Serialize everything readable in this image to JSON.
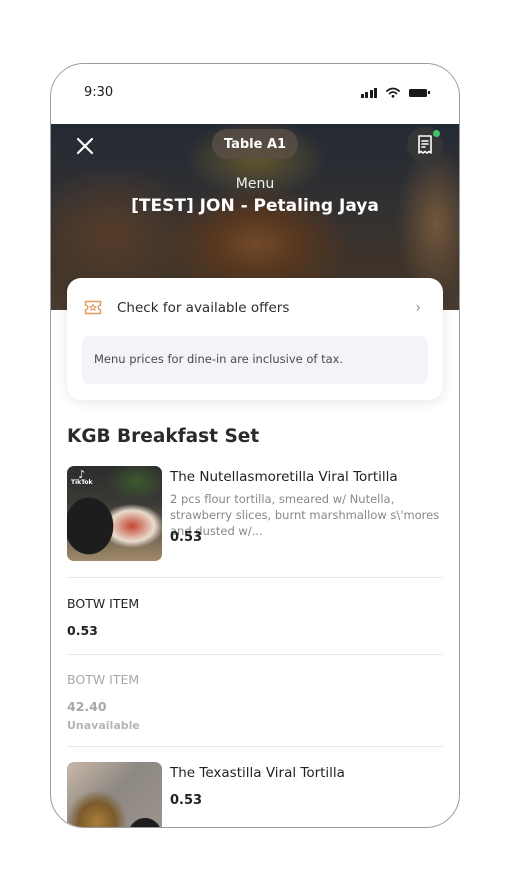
{
  "status_bar": {
    "time": "9:30",
    "icons": [
      "signal-icon",
      "wifi-icon",
      "battery-icon"
    ]
  },
  "header": {
    "close_icon": "close-icon",
    "table_label": "Table A1",
    "receipt_icon": "receipt-icon",
    "receipt_badge_color": "#3fc66b",
    "subtitle": "Menu",
    "title": "[TEST] JON - Petaling Jaya"
  },
  "offers": {
    "icon": "ticket-icon",
    "label": "Check for available offers",
    "chevron": "›",
    "accent_color": "#e39a5a",
    "tax_note": "Menu prices for dine-in are inclusive of tax."
  },
  "menu": {
    "section_title": "KGB Breakfast Set",
    "items": [
      {
        "name": "The Nutellasmoretilla Viral Tortilla",
        "description": "2 pcs flour tortilla, smeared w/ Nutella, strawberry slices, burnt marshmallow s\\'mores and dusted w/...",
        "price": "0.53",
        "image_badge": "TikTok",
        "available": true
      },
      {
        "name": "BOTW ITEM",
        "price": "0.53",
        "available": true
      },
      {
        "name": "BOTW ITEM",
        "price": "42.40",
        "status": "Unavailable",
        "available": false
      },
      {
        "name": "The Texastilla Viral Tortilla",
        "price": "0.53",
        "available": true
      }
    ]
  }
}
